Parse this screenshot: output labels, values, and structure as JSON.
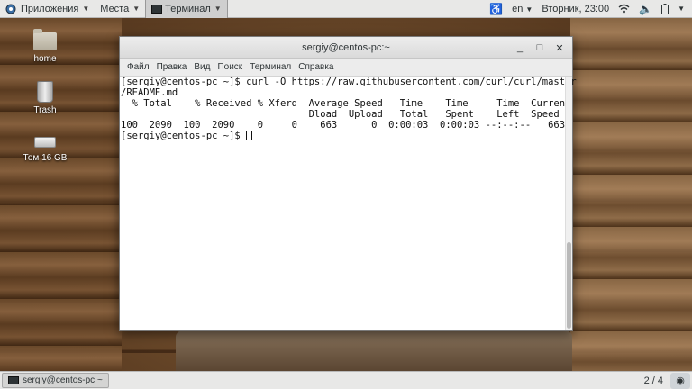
{
  "top_panel": {
    "apps_label": "Приложения",
    "places_label": "Места",
    "terminal_label": "Терминал",
    "lang": "en",
    "datetime": "Вторник, 23:00"
  },
  "desktop_icons": {
    "home": "home",
    "trash": "Trash",
    "volume": "Том 16 GB"
  },
  "terminal": {
    "title": "sergiy@centos-pc:~",
    "menu": [
      "Файл",
      "Правка",
      "Вид",
      "Поиск",
      "Терминал",
      "Справка"
    ],
    "lines": [
      "[sergiy@centos-pc ~]$ curl -O https://raw.githubusercontent.com/curl/curl/master",
      "/README.md",
      "  % Total    % Received % Xferd  Average Speed   Time    Time     Time  Current",
      "                                 Dload  Upload   Total   Spent    Left  Speed",
      "100  2090  100  2090    0     0    663      0  0:00:03  0:00:03 --:--:--   663"
    ],
    "prompt": "[sergiy@centos-pc ~]$ "
  },
  "bottom_panel": {
    "task_label": "sergiy@centos-pc:~",
    "workspace": "2 / 4"
  }
}
